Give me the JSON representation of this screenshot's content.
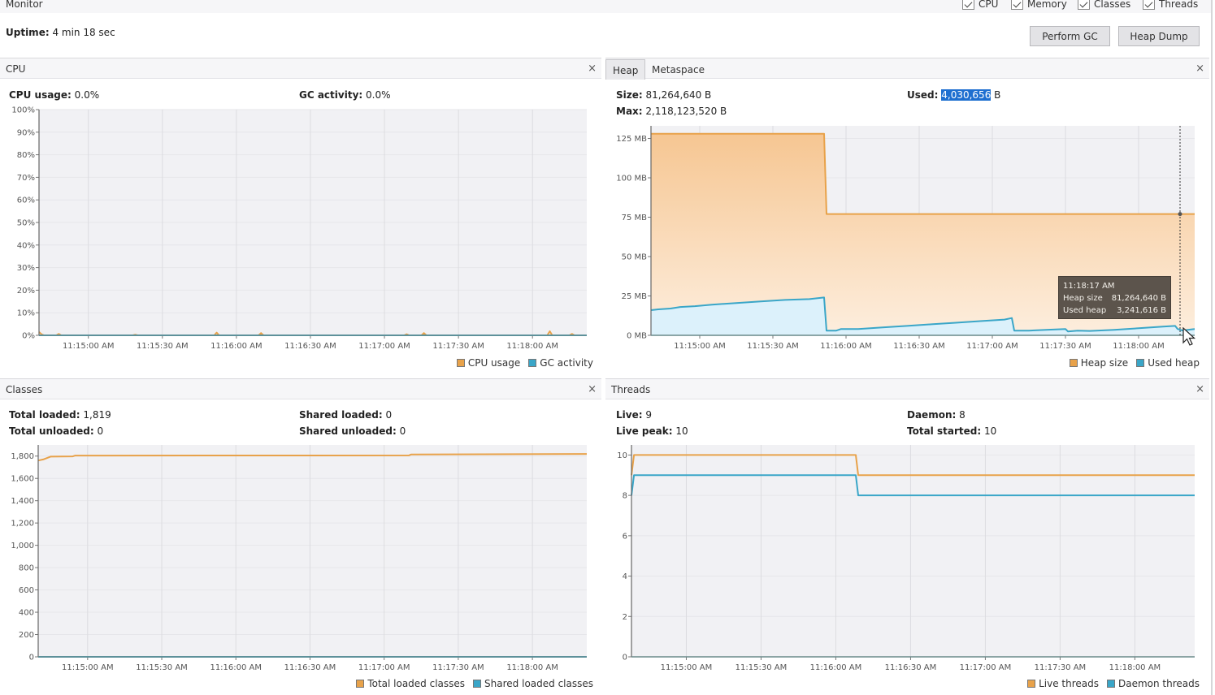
{
  "window": {
    "title": "Monitor",
    "uptime_label": "Uptime:",
    "uptime_value": "4 min 18 sec",
    "checkboxes": [
      {
        "label": "CPU",
        "checked": true
      },
      {
        "label": "Memory",
        "checked": true
      },
      {
        "label": "Classes",
        "checked": true
      },
      {
        "label": "Threads",
        "checked": true
      }
    ],
    "buttons": {
      "perform_gc": "Perform GC",
      "heap_dump": "Heap Dump"
    },
    "close_glyph": "×"
  },
  "colors": {
    "orange": "#e8a24a",
    "blue": "#3aa6c8",
    "orange_fill_top": "#f6c692",
    "orange_fill_bottom": "#fdeede",
    "blue_fill": "#dcf1fb",
    "plot_bg": "#f1f1f4",
    "grid": "#dcdce0"
  },
  "cpu": {
    "title": "CPU",
    "stats": {
      "usage_label": "CPU usage:",
      "usage_value": "0.0%",
      "gc_label": "GC activity:",
      "gc_value": "0.0%"
    },
    "legend": [
      "CPU usage",
      "GC activity"
    ]
  },
  "heap": {
    "tabs": [
      "Heap",
      "Metaspace"
    ],
    "active_tab": "Heap",
    "stats": {
      "size_label": "Size:",
      "size_value": "81,264,640 B",
      "max_label": "Max:",
      "max_value": "2,118,123,520 B",
      "used_label": "Used:",
      "used_value_selected": "4,030,656",
      "used_unit": " B"
    },
    "legend": [
      "Heap size",
      "Used heap"
    ],
    "tooltip": {
      "time": "11:18:17 AM",
      "rows": [
        {
          "label": "Heap size",
          "value": "81,264,640 B"
        },
        {
          "label": "Used heap",
          "value": "3,241,616 B"
        }
      ]
    }
  },
  "classes": {
    "title": "Classes",
    "stats": {
      "total_loaded_label": "Total loaded:",
      "total_loaded_value": "1,819",
      "total_unloaded_label": "Total unloaded:",
      "total_unloaded_value": "0",
      "shared_loaded_label": "Shared loaded:",
      "shared_loaded_value": "0",
      "shared_unloaded_label": "Shared unloaded:",
      "shared_unloaded_value": "0"
    },
    "legend": [
      "Total loaded classes",
      "Shared loaded classes"
    ]
  },
  "threads": {
    "title": "Threads",
    "stats": {
      "live_label": "Live:",
      "live_value": "9",
      "live_peak_label": "Live peak:",
      "live_peak_value": "10",
      "daemon_label": "Daemon:",
      "daemon_value": "8",
      "total_started_label": "Total started:",
      "total_started_value": "10"
    },
    "legend": [
      "Live threads",
      "Daemon threads"
    ]
  },
  "chart_data": [
    {
      "id": "cpu",
      "type": "line",
      "title": "CPU",
      "x_unit": "seconds since 11:14:40 AM",
      "xlim": [
        0,
        222
      ],
      "ylim": [
        0,
        100
      ],
      "y_ticks": [
        0,
        10,
        20,
        30,
        40,
        50,
        60,
        70,
        80,
        90,
        100
      ],
      "y_tick_labels": [
        "0%",
        "10%",
        "20%",
        "30%",
        "40%",
        "50%",
        "60%",
        "70%",
        "80%",
        "90%",
        "100%"
      ],
      "x_ticks": [
        20,
        50,
        80,
        110,
        140,
        170,
        200
      ],
      "x_tick_labels": [
        "11:15:00 AM",
        "11:15:30 AM",
        "11:16:00 AM",
        "11:16:30 AM",
        "11:17:00 AM",
        "11:17:30 AM",
        "11:18:00 AM"
      ],
      "grid": true,
      "legend_position": "bottom-right",
      "series": [
        {
          "name": "CPU usage",
          "color": "#e8a24a",
          "points": [
            [
              0,
              1.5
            ],
            [
              1,
              0.5
            ],
            [
              2,
              0
            ],
            [
              7,
              0
            ],
            [
              8,
              0.6
            ],
            [
              9,
              0
            ],
            [
              38,
              0
            ],
            [
              39,
              0.3
            ],
            [
              40,
              0
            ],
            [
              71,
              0
            ],
            [
              72,
              1.2
            ],
            [
              73,
              0
            ],
            [
              89,
              0
            ],
            [
              90,
              1
            ],
            [
              91,
              0
            ],
            [
              148,
              0
            ],
            [
              149,
              0.5
            ],
            [
              150,
              0
            ],
            [
              155,
              0
            ],
            [
              156,
              1
            ],
            [
              157,
              0
            ],
            [
              206,
              0
            ],
            [
              207,
              1.8
            ],
            [
              208,
              0
            ],
            [
              215,
              0
            ],
            [
              216,
              0.6
            ],
            [
              217,
              0
            ],
            [
              222,
              0
            ]
          ]
        },
        {
          "name": "GC activity",
          "color": "#3aa6c8",
          "points": [
            [
              0,
              0
            ],
            [
              222,
              0
            ]
          ]
        }
      ]
    },
    {
      "id": "heap",
      "type": "area",
      "title": "Heap",
      "x_unit": "seconds since 11:14:40 AM",
      "xlim": [
        0,
        223
      ],
      "ylim": [
        0,
        133
      ],
      "y_ticks": [
        0,
        25,
        50,
        75,
        100,
        125
      ],
      "y_tick_labels": [
        "0 MB",
        "25 MB",
        "50 MB",
        "75 MB",
        "100 MB",
        "125 MB"
      ],
      "x_ticks": [
        20,
        50,
        80,
        110,
        140,
        170,
        200
      ],
      "x_tick_labels": [
        "11:15:00 AM",
        "11:15:30 AM",
        "11:16:00 AM",
        "11:16:30 AM",
        "11:17:00 AM",
        "11:17:30 AM",
        "11:18:00 AM"
      ],
      "grid": true,
      "legend_position": "bottom-right",
      "cursor_x": 217,
      "series": [
        {
          "name": "Heap size",
          "color": "#e8a24a",
          "points": [
            [
              0,
              128
            ],
            [
              71,
              128
            ],
            [
              72,
              77
            ],
            [
              223,
              77
            ]
          ]
        },
        {
          "name": "Used heap",
          "color": "#3aa6c8",
          "points": [
            [
              0,
              16
            ],
            [
              3,
              16.5
            ],
            [
              8,
              17
            ],
            [
              12,
              18
            ],
            [
              18,
              18.5
            ],
            [
              25,
              19.5
            ],
            [
              35,
              20.5
            ],
            [
              45,
              21.5
            ],
            [
              55,
              22.5
            ],
            [
              65,
              23
            ],
            [
              71,
              24
            ],
            [
              72,
              3
            ],
            [
              76,
              3
            ],
            [
              78,
              4
            ],
            [
              85,
              4
            ],
            [
              95,
              5
            ],
            [
              105,
              6
            ],
            [
              115,
              7
            ],
            [
              125,
              8
            ],
            [
              135,
              9
            ],
            [
              145,
              10
            ],
            [
              148,
              11
            ],
            [
              149,
              3
            ],
            [
              155,
              3
            ],
            [
              162,
              3.5
            ],
            [
              170,
              4
            ],
            [
              171,
              2.5
            ],
            [
              175,
              3
            ],
            [
              180,
              2.8
            ],
            [
              190,
              3.5
            ],
            [
              200,
              4.5
            ],
            [
              210,
              5.5
            ],
            [
              215,
              6
            ],
            [
              216,
              4
            ],
            [
              218,
              3.1
            ],
            [
              223,
              4
            ]
          ]
        }
      ]
    },
    {
      "id": "classes",
      "type": "line",
      "title": "Classes",
      "x_unit": "seconds since 11:14:40 AM",
      "xlim": [
        0,
        222
      ],
      "ylim": [
        0,
        1900
      ],
      "y_ticks": [
        0,
        200,
        400,
        600,
        800,
        1000,
        1200,
        1400,
        1600,
        1800
      ],
      "y_tick_labels": [
        "0",
        "200",
        "400",
        "600",
        "800",
        "1,000",
        "1,200",
        "1,400",
        "1,600",
        "1,800"
      ],
      "x_ticks": [
        20,
        50,
        80,
        110,
        140,
        170,
        200
      ],
      "x_tick_labels": [
        "11:15:00 AM",
        "11:15:30 AM",
        "11:16:00 AM",
        "11:16:30 AM",
        "11:17:00 AM",
        "11:17:30 AM",
        "11:18:00 AM"
      ],
      "grid": true,
      "legend_position": "bottom-right",
      "series": [
        {
          "name": "Total loaded classes",
          "color": "#e8a24a",
          "points": [
            [
              0,
              1760
            ],
            [
              2,
              1770
            ],
            [
              5,
              1795
            ],
            [
              14,
              1797
            ],
            [
              15,
              1805
            ],
            [
              150,
              1806
            ],
            [
              151,
              1815
            ],
            [
              222,
              1819
            ]
          ]
        },
        {
          "name": "Shared loaded classes",
          "color": "#3aa6c8",
          "points": [
            [
              0,
              0
            ],
            [
              222,
              0
            ]
          ]
        }
      ]
    },
    {
      "id": "threads",
      "type": "line",
      "title": "Threads",
      "x_unit": "seconds since 11:14:40 AM",
      "xlim": [
        -2,
        224
      ],
      "ylim": [
        0,
        10.5
      ],
      "y_ticks": [
        0,
        2,
        4,
        6,
        8,
        10
      ],
      "y_tick_labels": [
        "0",
        "2",
        "4",
        "6",
        "8",
        "10"
      ],
      "x_ticks": [
        20,
        50,
        80,
        110,
        140,
        170,
        200
      ],
      "x_tick_labels": [
        "11:15:00 AM",
        "11:15:30 AM",
        "11:16:00 AM",
        "11:16:30 AM",
        "11:17:00 AM",
        "11:17:30 AM",
        "11:18:00 AM"
      ],
      "grid": true,
      "legend_position": "bottom-right",
      "series": [
        {
          "name": "Live threads",
          "color": "#e8a24a",
          "points": [
            [
              -2,
              9
            ],
            [
              -1,
              10
            ],
            [
              88,
              10
            ],
            [
              89,
              9
            ],
            [
              224,
              9
            ]
          ]
        },
        {
          "name": "Daemon threads",
          "color": "#3aa6c8",
          "points": [
            [
              -2,
              8
            ],
            [
              -1,
              9
            ],
            [
              88,
              9
            ],
            [
              89,
              8
            ],
            [
              224,
              8
            ]
          ]
        }
      ]
    }
  ]
}
